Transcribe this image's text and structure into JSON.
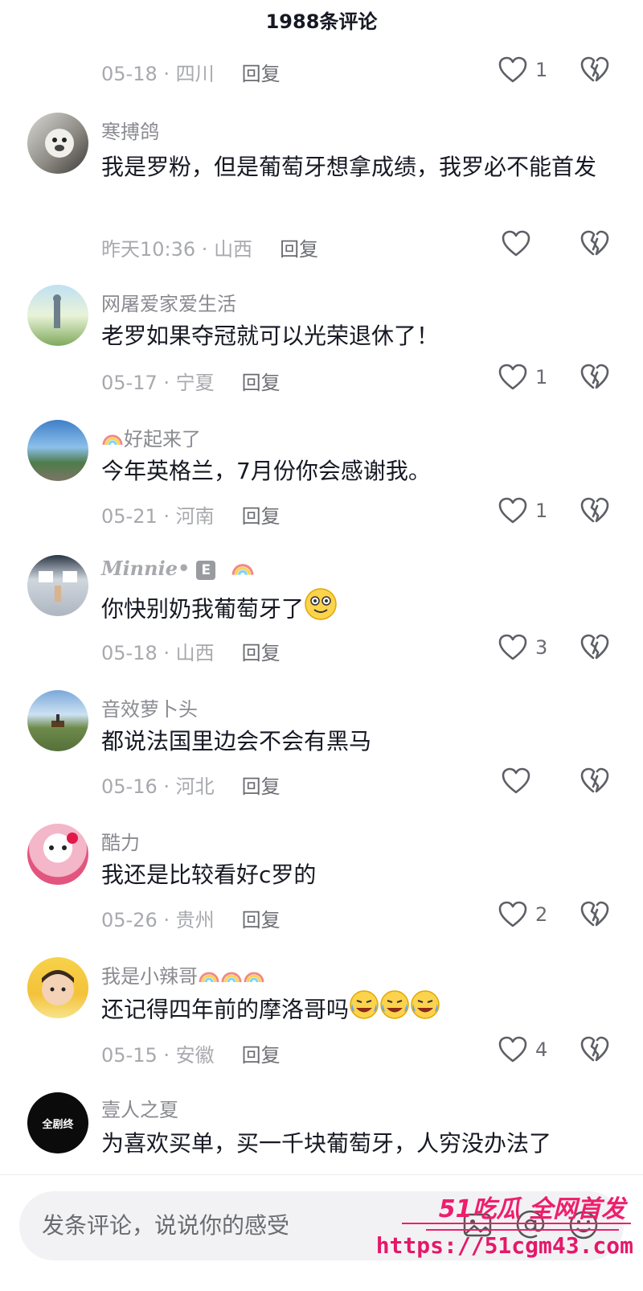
{
  "header": {
    "title": "1988条评论"
  },
  "top_meta": {
    "date": "05-18",
    "region": "四川",
    "reply": "回复",
    "likes": "1"
  },
  "comments": [
    {
      "name": "寒搏鸽",
      "text": "我是罗粉，但是葡萄牙想拿成绩，我罗必不能首发",
      "date": "昨天10:36",
      "region": "山西",
      "reply": "回复",
      "likes": ""
    },
    {
      "name": "网屠爱家爱生活",
      "text": "老罗如果夺冠就可以光荣退休了！",
      "date": "05-17",
      "region": "宁夏",
      "reply": "回复",
      "likes": "1"
    },
    {
      "name": "好起来了",
      "text": "今年英格兰，7月份你会感谢我。",
      "date": "05-21",
      "region": "河南",
      "reply": "回复",
      "likes": "1"
    },
    {
      "name": "Minnie•",
      "badge": "E",
      "text": "你快别奶我葡萄牙了",
      "date": "05-18",
      "region": "山西",
      "reply": "回复",
      "likes": "3"
    },
    {
      "name": "音效萝卜头",
      "text": "都说法国里边会不会有黑马",
      "date": "05-16",
      "region": "河北",
      "reply": "回复",
      "likes": ""
    },
    {
      "name": "酷力",
      "text": "我还是比较看好c罗的",
      "date": "05-26",
      "region": "贵州",
      "reply": "回复",
      "likes": "2"
    },
    {
      "name": "我是小辣哥",
      "text": "还记得四年前的摩洛哥吗",
      "date": "05-15",
      "region": "安徽",
      "reply": "回复",
      "likes": "4"
    },
    {
      "name": "壹人之夏",
      "avatar_text": "全剧终",
      "text": "为喜欢买单，买一千块葡萄牙，人穷没办法了"
    }
  ],
  "input": {
    "placeholder": "发条评论，说说你的感受"
  },
  "watermark": {
    "line1": "51吃瓜 全网首发",
    "line2": "https://51cgm43.com"
  },
  "colors": {
    "meta": "#a8a9ae",
    "text": "#161823",
    "watermark": "#ee1e6d"
  },
  "icons": [
    "heart-outline-icon",
    "broken-heart-icon",
    "image-icon",
    "at-icon",
    "emoji-icon",
    "rainbow-emoji",
    "smile-emoji",
    "laugh-cry-emoji"
  ]
}
